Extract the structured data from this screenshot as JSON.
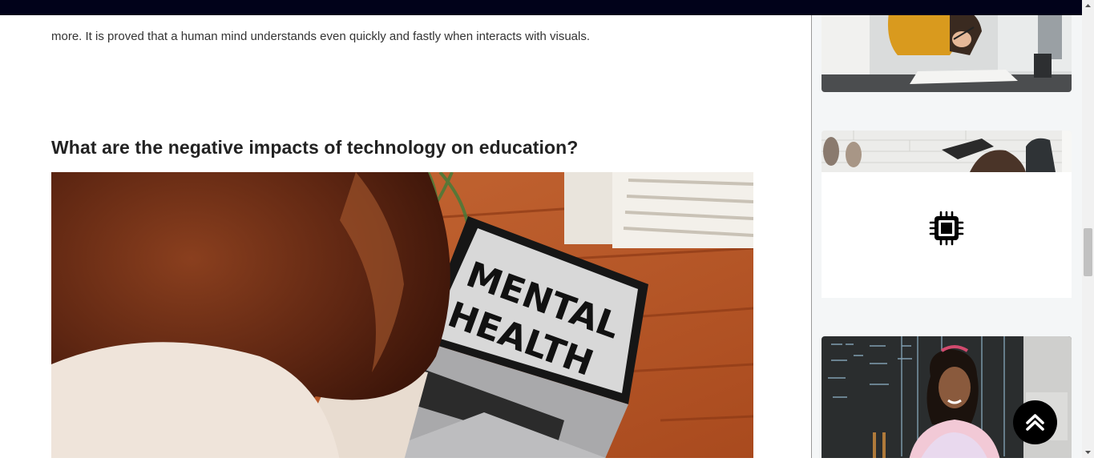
{
  "article": {
    "intro_text": "more. It is proved that a human mind understands even quickly and fastly when interacts with visuals.",
    "heading": "What are the negative impacts of technology on education?",
    "hero_image": {
      "laptop_screen_line_1": "MENTAL",
      "laptop_screen_line_2": "HEALTH"
    }
  },
  "sidebar": {
    "cards": [
      {
        "icon": "photo-student-writing"
      },
      {
        "icon": "photo-student-lying"
      },
      {
        "icon": "photo-girl-chalkboard"
      }
    ],
    "ad": {
      "icon": "cpu-chip-icon"
    }
  },
  "controls": {
    "back_to_top_icon": "double-chevron-up-icon"
  },
  "colors": {
    "topbar": "#01021a",
    "sidebar_background": "#f4f6f7",
    "back_to_top": "#000000"
  }
}
